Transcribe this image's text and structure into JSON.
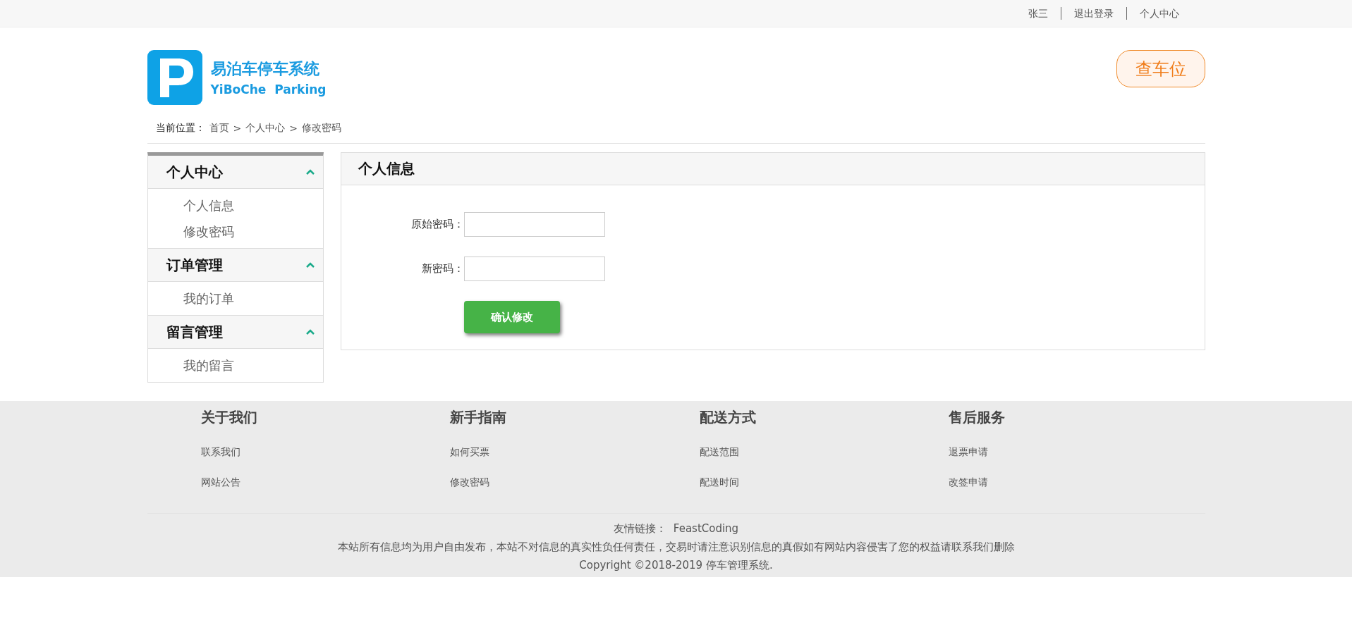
{
  "top_bar": {
    "links": [
      "张三",
      "退出登录",
      "个人中心"
    ]
  },
  "header": {
    "logo_title": "易泊车停车系统",
    "logo_subtitle": "YiBoChe  Parking",
    "action_button": "查车位"
  },
  "breadcrumb": {
    "label": "当前位置：",
    "items": [
      "首页",
      "个人中心",
      "修改密码"
    ],
    "separator": ">"
  },
  "sidebar": {
    "groups": [
      {
        "title": "个人中心",
        "expanded": true,
        "items": [
          "个人信息",
          "修改密码"
        ]
      },
      {
        "title": "订单管理",
        "expanded": true,
        "items": [
          "我的订单"
        ]
      },
      {
        "title": "留言管理",
        "expanded": true,
        "items": [
          "我的留言"
        ]
      }
    ]
  },
  "panel": {
    "title": "个人信息",
    "fields": [
      {
        "label": "原始密码："
      },
      {
        "label": "新密码："
      }
    ],
    "submit": "确认修改"
  },
  "footer": {
    "columns": [
      {
        "title": "关于我们",
        "links": [
          "联系我们",
          "网站公告"
        ]
      },
      {
        "title": "新手指南",
        "links": [
          "如何买票",
          "修改密码"
        ]
      },
      {
        "title": "配送方式",
        "links": [
          "配送范围",
          "配送时间"
        ]
      },
      {
        "title": "售后服务",
        "links": [
          "退票申请",
          "改签申请"
        ]
      }
    ],
    "friend_label": "友情链接：",
    "friend_link": "FeastCoding",
    "notice": "本站所有信息均为用户自由发布，本站不对信息的真实性负任何责任，交易时请注意识别信息的真假如有网站内容侵害了您的权益请联系我们删除",
    "copyright": "Copyright ©2018-2019 停车管理系统."
  }
}
